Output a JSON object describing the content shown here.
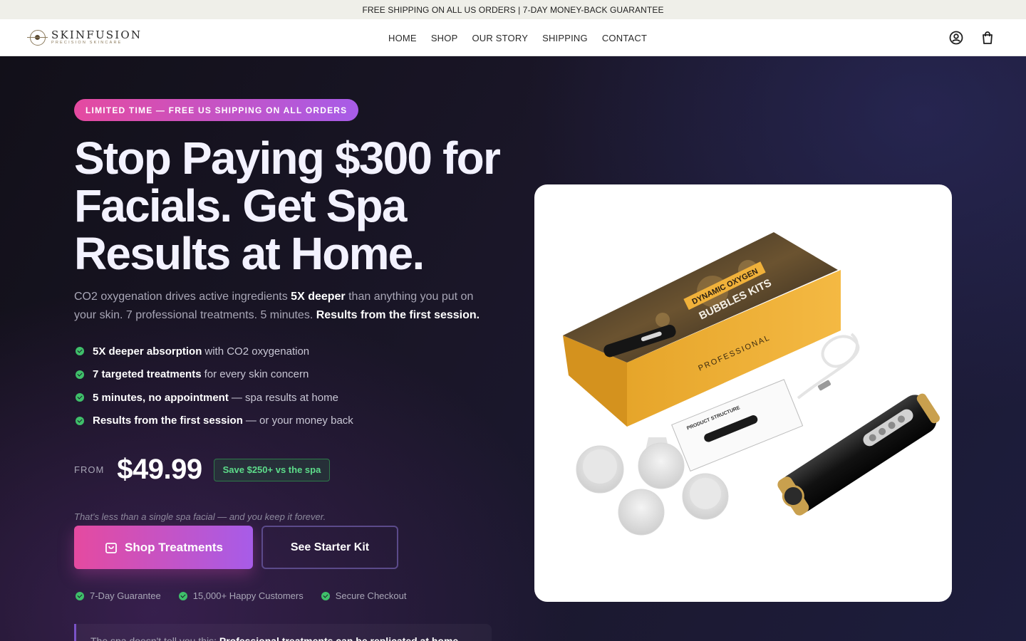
{
  "announcement": "FREE SHIPPING ON ALL US ORDERS | 7-DAY MONEY-BACK GUARANTEE",
  "header": {
    "logo_name": "SKINFUSION",
    "logo_tagline": "PRECISION SKINCARE",
    "nav": [
      "HOME",
      "SHOP",
      "OUR STORY",
      "SHIPPING",
      "CONTACT"
    ],
    "icons": [
      "account-icon",
      "cart-icon"
    ]
  },
  "hero": {
    "badge": "LIMITED TIME — FREE US SHIPPING ON ALL ORDERS",
    "headline": "Stop Paying $300 for Facials. Get Spa Results at Home.",
    "sub": {
      "part1": "CO2 oxygenation drives active ingredients ",
      "bold1": "5X deeper",
      "part2": " than anything you put on your skin. 7 professional treatments. 5 minutes. ",
      "bold2": "Results from the first session."
    },
    "bullets": [
      {
        "bold": "5X deeper absorption",
        "rest": "with CO2 oxygenation"
      },
      {
        "bold": "7 targeted treatments",
        "rest": "for every skin concern"
      },
      {
        "bold": "5 minutes, no appointment",
        "rest": "— spa results at home"
      },
      {
        "bold": "Results from the first session",
        "rest": "— or your money back"
      }
    ],
    "price_prefix": "FROM",
    "price": "$49.99",
    "save_badge": "Save $250+ vs the spa",
    "note": "That's less than a single spa facial — and you keep it forever.",
    "cta_primary": "Shop Treatments",
    "cta_secondary": "See Starter Kit",
    "trust": [
      "7-Day Guarantee",
      "15,000+ Happy Customers",
      "Secure Checkout"
    ],
    "quote_lead": "The spa doesn't tell you this:",
    "quote_bold": "Professional treatments can be replicated at home"
  },
  "product_image": {
    "box_label_1": "DYNAMIC OXYGEN",
    "box_label_2": "BUBBLES KITS",
    "box_side": "PROFESSIONAL",
    "card_label": "PRODUCT STRUCTURE"
  },
  "colors": {
    "accent_gradient_start": "#e54aa0",
    "accent_gradient_end": "#a75ce8",
    "check_green": "#3fbf6a",
    "save_green": "#5ddc8a"
  }
}
